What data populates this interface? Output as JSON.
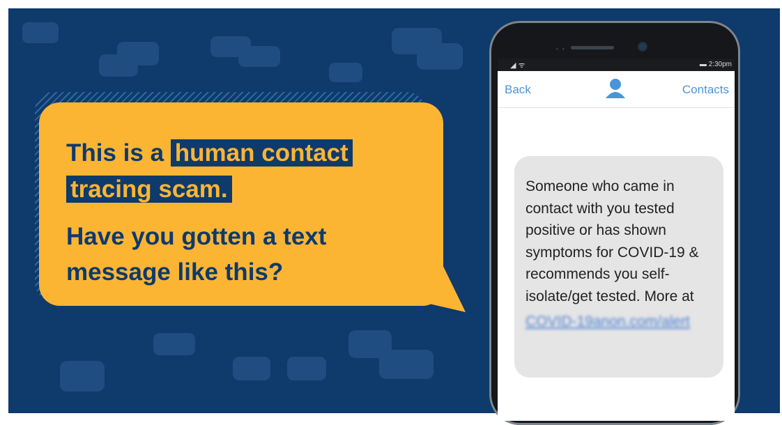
{
  "headline": {
    "line1_plain": "This is a ",
    "line1_highlight": "human contact",
    "line2_highlight": "tracing scam.",
    "question_line1": "Have you gotten a text",
    "question_line2": "message like this?"
  },
  "phone": {
    "status_time": "2:30pm",
    "nav_back": "Back",
    "nav_contacts": "Contacts",
    "message_text": "Someone who came in contact with you tested positive or has shown symptoms for COVID-19 & recommends you self-isolate/get tested. More at",
    "message_link": "COVID-19anon.com/alert"
  },
  "colors": {
    "background": "#0e3a6c",
    "bubble": "#fbb533",
    "link": "#4a95d9"
  }
}
